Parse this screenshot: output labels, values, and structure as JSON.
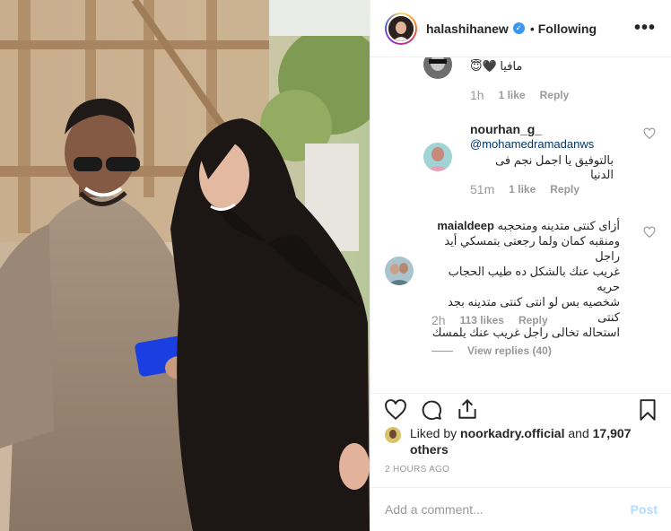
{
  "header": {
    "username": "halashihanew",
    "separator": "•",
    "follow_status": "Following",
    "more_label": "•••"
  },
  "comments": [
    {
      "username": "",
      "text": "مافيا 🖤😇",
      "time": "1h",
      "likes": "1 like",
      "reply": "Reply"
    },
    {
      "username": "nourhan_g_",
      "mention": "@mohamedramadanws",
      "text": "بالتوفيق يا اجمل نجم فى الدنيا",
      "time": "51m",
      "likes": "1 like",
      "reply": "Reply"
    },
    {
      "username": "maialdeep",
      "lines": [
        "أزاى كنتى متدينه ومتحجبه",
        "ومنقبه كمان ولما رجعتى بتمسكي أيد راجل",
        "غريب عنك بالشكل ده طيب الحجاب حريه",
        "شخصيه بس لو انتى كنتى متدينه بجد كنتى",
        "استحاله تخالى راجل غريب عنك يلمسك"
      ],
      "time": "2h",
      "likes": "113 likes",
      "reply": "Reply",
      "view_replies": "View replies (40)"
    }
  ],
  "likes": {
    "prefix": "Liked by",
    "user": "noorkadry.official",
    "and": "and",
    "others": "17,907 others"
  },
  "timestamp": "2 HOURS AGO",
  "add_comment": {
    "placeholder": "Add a comment...",
    "post_label": "Post"
  },
  "colors": {
    "verified": "#3897f0",
    "muted": "#999999",
    "post_disabled": "#b3dbff",
    "text": "#262626"
  },
  "icons": [
    "heart-icon",
    "comment-icon",
    "share-icon",
    "bookmark-icon",
    "verified-icon",
    "more-icon"
  ]
}
